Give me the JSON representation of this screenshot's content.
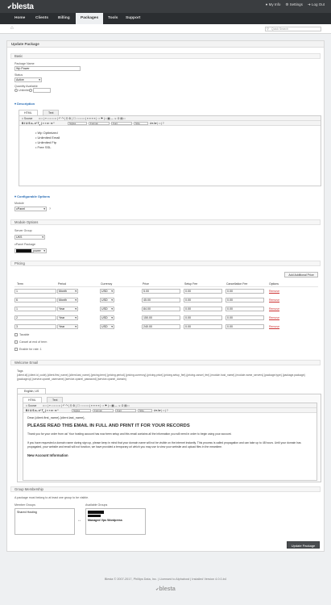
{
  "brand": {
    "logo": "blesta"
  },
  "top_links": {
    "my_info": "My Info",
    "settings": "Settings",
    "log_out": "Log Out"
  },
  "nav": {
    "home": "Home",
    "clients": "Clients",
    "billing": "Billing",
    "packages": "Packages",
    "tools": "Tools",
    "support": "Support"
  },
  "search": {
    "placeholder": "Quick Search"
  },
  "page": {
    "title": "Update Package"
  },
  "basic": {
    "section": "Basic",
    "name_label": "Package Name",
    "name_value": "Wp Power",
    "status_label": "Status",
    "status_value": "Active",
    "quantity_label": "Quantity Available",
    "unlimited_label": "Unlimited"
  },
  "description": {
    "toggle": "Description",
    "tab_html": "HTML",
    "tab_text": "Text",
    "toolbar": {
      "source": "Source",
      "styles": "Styles",
      "format": "Format",
      "font": "Font",
      "size": "Size"
    },
    "items": [
      "Wp Optimized",
      "Unlimited Email",
      "Unlimited Ftp",
      "Free SSL"
    ]
  },
  "configurable": {
    "toggle": "Configurable Options",
    "label": "Module",
    "value": "cPanel"
  },
  "module_options": {
    "section": "Module Options",
    "server_group_label": "Server Group",
    "server_group_value": "UKS",
    "cpanel_package_label": "cPanel Package",
    "cpanel_package_value": "_power"
  },
  "pricing": {
    "section": "Pricing",
    "add_button": "Add Additional Price",
    "headers": [
      "Term",
      "Period",
      "Currency",
      "Price",
      "Setup Fee",
      "Cancellation Fee",
      "Options"
    ],
    "rows": [
      {
        "term": "1",
        "period": "Month",
        "currency": "USD",
        "price": "5.00",
        "setup": "0.00",
        "cancel": "0.00",
        "option": "Remove"
      },
      {
        "term": "6",
        "period": "Month",
        "currency": "USD",
        "price": "45.00",
        "setup": "0.00",
        "cancel": "0.00",
        "option": "Remove"
      },
      {
        "term": "1",
        "period": "Year",
        "currency": "USD",
        "price": "84.00",
        "setup": "0.00",
        "cancel": "0.00",
        "option": "Remove"
      },
      {
        "term": "2",
        "period": "Year",
        "currency": "USD",
        "price": "150.00",
        "setup": "0.00",
        "cancel": "0.00",
        "option": "Remove"
      },
      {
        "term": "3",
        "period": "Year",
        "currency": "USD",
        "price": "240.00",
        "setup": "0.00",
        "cancel": "0.00",
        "option": "Remove"
      }
    ],
    "taxable": "Taxable",
    "cancel_at_end": "Cancel at end of term",
    "prorate": "Enable for rate: 1"
  },
  "welcome_email": {
    "section": "Welcome Email",
    "tags_label": "Tags",
    "tags": "{client.id} {client.id_code} {client.first_name} {client.last_name} {pricing.term} {pricing.period} {pricing.currency} {pricing.price} {pricing.setup_fee} {pricing.cancel_fee} {module.host_name} {module.name_servers} {package.type} {package.package} {package.ip} {service.cpanel_username} {service.cpanel_password} {service.cpanel_domain}",
    "lang_tab": "English, US",
    "tab_html": "HTML",
    "tab_text": "Text",
    "greeting": "Dear {client.first_name} {client.last_name},",
    "heading": "PLEASE READ THIS EMAIL IN FULL AND PRINT IT FOR YOUR RECORDS",
    "para1": "Thank you for your order from us! Your hosting account has now been setup and this email contains all the information you will need in order to begin using your account.",
    "para2": "If you have requested a domain name during sign up, please keep in mind that your domain name will not be visible on the internet instantly. This process is called propagation and can take up to 48 hours. Until your domain has propagated, your website and email will not function, we have provided a temporary url which you may use to view your website and upload files in the meantime.",
    "subheading": "New Account Information"
  },
  "group": {
    "section": "Group Membership",
    "note": "A package must belong to at least one group to be visible.",
    "member_label": "Member Groups",
    "available_label": "Available Groups",
    "member_items": [
      "Shared Hosting"
    ],
    "available_items": [
      "Managed Vps Wordpress"
    ]
  },
  "submit": {
    "label": "Update Package"
  },
  "footer": {
    "copyright": "Blesta © 2007-2017, Phillips Data, Inc. | Licensed to Alphahost | Installed Version 4.0.0-b4",
    "logo": "blesta"
  }
}
